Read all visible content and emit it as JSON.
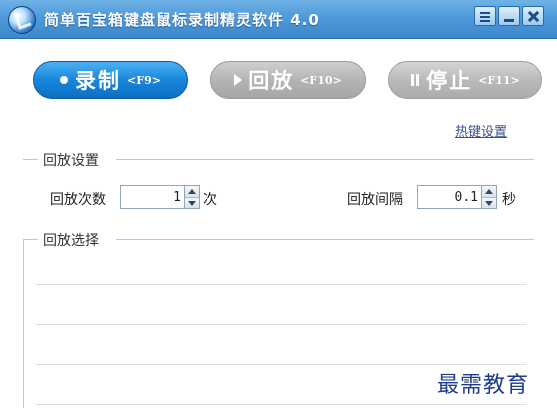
{
  "window": {
    "title": "简单百宝箱键盘鼠标录制精灵软件 4.0"
  },
  "toolbar": {
    "record": {
      "label": "录制",
      "key": "<F9>"
    },
    "play": {
      "label": "回放",
      "key": "<F10>"
    },
    "stop": {
      "label": "停止",
      "key": "<F11>"
    }
  },
  "hotkey_link": "热键设置",
  "playback_settings": {
    "group_title": "回放设置",
    "count_label": "回放次数",
    "count_value": "1",
    "count_unit": "次",
    "interval_label": "回放间隔",
    "interval_value": "0.1",
    "interval_unit": "秒"
  },
  "playback_select": {
    "group_title": "回放选择"
  },
  "watermark": "最需教育",
  "colors": {
    "titlebar": "#4f9ada",
    "record_button": "#1a86db",
    "disabled_button": "#b4b4b4",
    "link": "#3a4f8a"
  }
}
